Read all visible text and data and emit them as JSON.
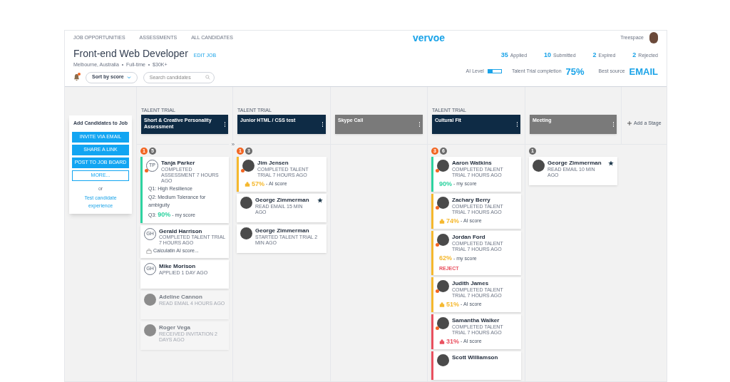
{
  "nav": [
    {
      "label": "JOB OPPORTUNITIES"
    },
    {
      "label": "ASSESSMENTS"
    },
    {
      "label": "ALL CANDIDATES"
    }
  ],
  "logo": "vervoe",
  "user": {
    "name": "Treespace"
  },
  "job": {
    "title": "Front-end Web Developer",
    "edit": "EDIT JOB",
    "details": "Melbourne, Australia  •  Full-time  •  $30K+"
  },
  "toolbar": {
    "notifications": true,
    "sort": "Sort by score",
    "search_placeholder": "Search candidates"
  },
  "stats": [
    {
      "value": "35",
      "label": "Applied"
    },
    {
      "value": "10",
      "label": "Submitted"
    },
    {
      "value": "2",
      "label": "Expired"
    },
    {
      "value": "2",
      "label": "Rejected"
    }
  ],
  "ai_level": {
    "label": "AI Level",
    "level": 0.34
  },
  "completion": {
    "label": "Talent Trial completion",
    "value": "75%"
  },
  "best_source": {
    "label": "Best source",
    "value": "EMAIL"
  },
  "add_panel": {
    "title": "Add Candidates to Job",
    "buttons": [
      {
        "label": "INVITE VIA EMAIL",
        "kind": "filled"
      },
      {
        "label": "SHARE A LINK",
        "kind": "filled"
      },
      {
        "label": "POST TO JOB BOARD",
        "kind": "filled"
      },
      {
        "label": "MORE...",
        "kind": "outline"
      }
    ],
    "or": "or",
    "link": "Test candidate experience"
  },
  "collapse": "»",
  "stages": [
    {
      "label": "TALENT TRIAL",
      "name": "Short & Creative Personality Assessment",
      "kind": "assessment",
      "badges": [
        {
          "count": "1",
          "kind": "new"
        },
        {
          "count": "5",
          "kind": "total"
        }
      ],
      "cards": [
        {
          "name": "Tanja Parker",
          "status": "COMPLETED ASSESSMENT 7 HOURS AGO",
          "avatar": {
            "kind": "initials",
            "text": "TP"
          },
          "alert": true,
          "color": "#2ed3a0",
          "muted": false,
          "starred": false,
          "answers": [
            "Q1: High Resilience",
            "Q2: Medium Tolerance for ambiguity"
          ],
          "score": {
            "kind": "my",
            "prefix": "Q3:",
            "value": "90%",
            "label": "- my score",
            "color": "#2ed3a0"
          }
        },
        {
          "name": "Gerald Harrison",
          "status": "COMPLETED TALENT TRIAL 7 HOURS AGO",
          "avatar": {
            "kind": "initials",
            "text": "GH"
          },
          "alert": false,
          "muted": false,
          "starred": false,
          "score": {
            "kind": "pending",
            "label": "Calculatin AI score..."
          }
        },
        {
          "name": "Mike Morison",
          "status": "APPLIED 1 DAY AGO",
          "avatar": {
            "kind": "initials",
            "text": "GH"
          },
          "alert": false,
          "muted": false,
          "starred": false
        },
        {
          "name": "Adeline Cannon",
          "status": "READ EMAIL 4 HOURS AGO",
          "avatar": {
            "kind": "photo"
          },
          "alert": false,
          "muted": true,
          "starred": false
        },
        {
          "name": "Roger Vega",
          "status": "RECEIVED INVITATION 2 DAYS AGO",
          "avatar": {
            "kind": "photo"
          },
          "alert": false,
          "muted": true,
          "starred": false
        }
      ]
    },
    {
      "label": "TALENT TRIAL",
      "name": "Junior HTML / CSS test",
      "kind": "assessment",
      "badges": [
        {
          "count": "1",
          "kind": "new"
        },
        {
          "count": "3",
          "kind": "total"
        }
      ],
      "cards": [
        {
          "name": "Jim Jensen",
          "status": "COMPLETED TALENT TRIAL 7 HOURS AGO",
          "avatar": {
            "kind": "photo"
          },
          "alert": true,
          "color": "#f5b82e",
          "muted": false,
          "starred": false,
          "score": {
            "kind": "ai",
            "value": "57%",
            "label": "- AI score",
            "color": "#f5b82e"
          }
        },
        {
          "name": "George Zimmerman",
          "status": "READ EMAIL 15 MIN AGO",
          "avatar": {
            "kind": "photo"
          },
          "alert": false,
          "muted": false,
          "starred": true
        },
        {
          "name": "George Zimmerman",
          "status": "STARTED TALENT TRIAL 2 MIN AGO",
          "avatar": {
            "kind": "photo"
          },
          "alert": false,
          "muted": false,
          "starred": false
        }
      ]
    },
    {
      "name": "Skype Call",
      "kind": "event"
    },
    {
      "label": "TALENT TRIAL",
      "name": "Cultural Fit",
      "kind": "assessment",
      "badges": [
        {
          "count": "3",
          "kind": "new"
        },
        {
          "count": "6",
          "kind": "total"
        }
      ],
      "cards": [
        {
          "name": "Aaron Watkins",
          "status": "COMPLETED TALENT TRIAL 7 HOURS AGO",
          "avatar": {
            "kind": "photo"
          },
          "alert": true,
          "color": "#2ed3a0",
          "muted": false,
          "starred": false,
          "score": {
            "kind": "my",
            "value": "90%",
            "label": "- my score",
            "color": "#2ed3a0"
          }
        },
        {
          "name": "Zachary Berry",
          "status": "COMPLETED TALENT TRIAL 7 HOURS AGO",
          "avatar": {
            "kind": "photo"
          },
          "alert": true,
          "color": "#f5b82e",
          "muted": false,
          "starred": false,
          "score": {
            "kind": "ai",
            "value": "74%",
            "label": "- AI score",
            "color": "#f5b82e"
          }
        },
        {
          "name": "Jordan Ford",
          "status": "COMPLETED TALENT TRIAL 7 HOURS AGO",
          "avatar": {
            "kind": "photo"
          },
          "alert": true,
          "color": "#f5b82e",
          "muted": false,
          "starred": false,
          "score": {
            "kind": "my",
            "value": "62%",
            "label": "- my score",
            "color": "#f5b82e"
          },
          "action": "REJECT"
        },
        {
          "name": "Judith James",
          "status": "COMPLETED TALENT TRIAL 7 HOURS AGO",
          "avatar": {
            "kind": "photo"
          },
          "alert": true,
          "color": "#f5b82e",
          "muted": false,
          "starred": false,
          "score": {
            "kind": "ai",
            "value": "51%",
            "label": "- AI score",
            "color": "#f5b82e"
          }
        },
        {
          "name": "Samantha Walker",
          "status": "COMPLETED TALENT TRIAL 7 HOURS AGO",
          "avatar": {
            "kind": "photo"
          },
          "alert": true,
          "color": "#e9505f",
          "muted": false,
          "starred": false,
          "score": {
            "kind": "ai",
            "value": "31%",
            "label": "- AI score",
            "color": "#e9505f"
          }
        },
        {
          "name": "Scott Williamson",
          "avatar": {
            "kind": "photo"
          },
          "alert": false,
          "color": "#e9505f",
          "muted": false,
          "starred": false
        }
      ]
    },
    {
      "name": "Meeting",
      "kind": "event",
      "badges": [
        {
          "count": "1",
          "kind": "total"
        }
      ],
      "cards": [
        {
          "name": "George Zimmerman",
          "status": "READ EMAIL 10 MIN AGO",
          "avatar": {
            "kind": "photo"
          },
          "alert": false,
          "muted": false,
          "starred": true
        }
      ]
    }
  ],
  "add_stage": "Add a Stage"
}
